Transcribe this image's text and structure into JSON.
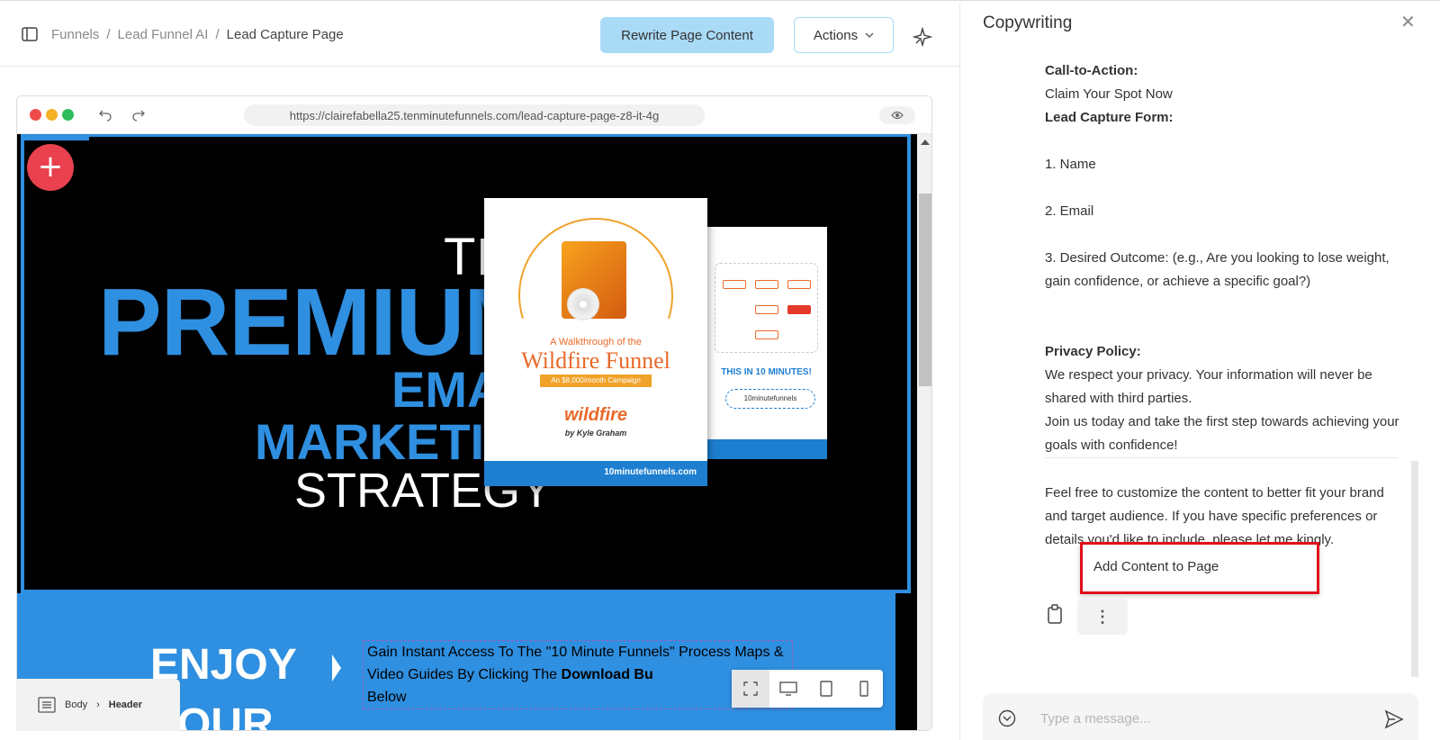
{
  "header": {
    "breadcrumbs": [
      "Funnels",
      "Lead Funnel AI",
      "Lead Capture Page"
    ],
    "separator": "/",
    "rewrite_button": "Rewrite Page Content",
    "actions_button": "Actions"
  },
  "browser": {
    "url": "https://clairefabella25.tenminutefunnels.com/lead-capture-page-z8-it-4g",
    "dot_colors": [
      "#ee4b4b",
      "#f4b125",
      "#2ebd5a"
    ]
  },
  "page": {
    "hero": {
      "line1": "TH",
      "line2": "PREMIUM",
      "line3": "EMA",
      "line4": "MARKETIN",
      "line5": "STRATEGY",
      "accent_color": "#2f8fe0"
    },
    "ebook": {
      "subtitle": "A Walkthrough of the",
      "title": "Wildfire Funnel",
      "ribbon": "An $8,000/month Campaign",
      "brand": "wildfire",
      "author": "by Kyle Graham",
      "logo_text": "10minutefunnels.com",
      "back_headline": "THIS IN 10 MINUTES!",
      "back_logo": "10minutefunnels"
    },
    "band": {
      "enjoy": "ENJOY",
      "enjoy2": "OUR",
      "text_before": "Gain Instant Access To The \"10 Minute Funnels\" Process Maps & Video Guides By Clicking The ",
      "text_bold": "Download Bu",
      "text_after": "Below"
    }
  },
  "bottom_bar": {
    "crumb_body": "Body",
    "crumb_header": "Header"
  },
  "panel": {
    "title": "Copywriting",
    "cta_label": "Call-to-Action:",
    "cta_value": "Claim Your Spot Now",
    "form_label": "Lead Capture Form:",
    "field1": "1. Name",
    "field2": "2. Email",
    "field3": "3. Desired Outcome: (e.g., Are you looking to lose weight, gain confidence, or achieve a specific goal?)",
    "privacy_label": "Privacy Policy:",
    "privacy_text1": "We respect your privacy. Your information will never be shared with third parties.",
    "privacy_text2": "Join us today and take the first step towards achieving your goals with confidence!",
    "closing_text_start": "Feel free to customize the content to better fit your brand and target audience. If you have specific prefe",
    "closing_text_end": "rences or details you'd like to include, please let me k",
    "closing_text_tail": "ingly.",
    "popup_item": "Add Content to Page",
    "more_label": "⋮",
    "chat_placeholder": "Type a message..."
  }
}
